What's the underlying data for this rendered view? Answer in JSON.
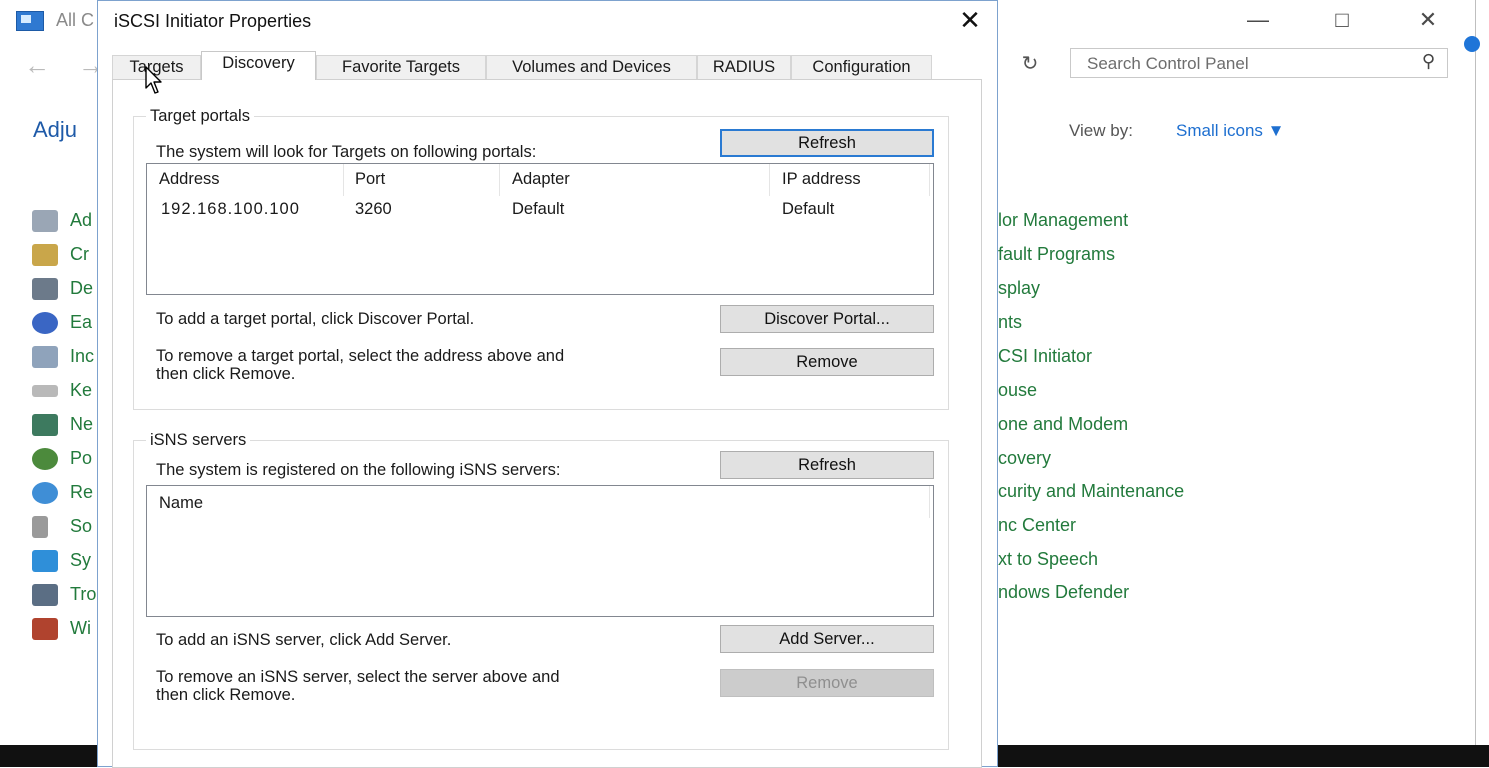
{
  "background_window": {
    "title": "All C",
    "heading": "Adju",
    "search_placeholder": "Search Control Panel",
    "view_by_label": "View by:",
    "view_by_value": "Small icons",
    "left_items": [
      "Ad",
      "Cr",
      "De",
      "Ea",
      "Inc",
      "Ke",
      "Ne",
      "Po",
      "Re",
      "So",
      "Sy",
      "Tro",
      "Wi"
    ],
    "right_items": [
      "lor Management",
      "fault Programs",
      "splay",
      "nts",
      "CSI Initiator",
      "ouse",
      "one and Modem",
      "covery",
      "curity and Maintenance",
      "nc Center",
      "xt to Speech",
      "ndows Defender"
    ]
  },
  "dialog": {
    "title": "iSCSI Initiator Properties",
    "tabs": [
      "Targets",
      "Discovery",
      "Favorite Targets",
      "Volumes and Devices",
      "RADIUS",
      "Configuration"
    ],
    "active_tab": "Discovery",
    "target_portals": {
      "group_title": "Target portals",
      "description": "The system will look for Targets on following portals:",
      "refresh_label": "Refresh",
      "columns": [
        "Address",
        "Port",
        "Adapter",
        "IP address"
      ],
      "rows": [
        {
          "address": "192.168.100.100",
          "port": "3260",
          "adapter": "Default",
          "ip_address": "Default"
        }
      ],
      "add_hint": "To add a target portal, click Discover Portal.",
      "discover_label": "Discover Portal...",
      "remove_hint_line1": "To remove a target portal, select the address above and",
      "remove_hint_line2": "then click Remove.",
      "remove_label": "Remove"
    },
    "isns_servers": {
      "group_title": "iSNS servers",
      "description": "The system is registered on the following iSNS servers:",
      "refresh_label": "Refresh",
      "columns": [
        "Name"
      ],
      "add_hint": "To add an iSNS server, click Add Server.",
      "add_label": "Add Server...",
      "remove_hint_line1": "To remove an iSNS server, select the server above and",
      "remove_hint_line2": "then click Remove.",
      "remove_label": "Remove",
      "remove_disabled": true
    }
  }
}
